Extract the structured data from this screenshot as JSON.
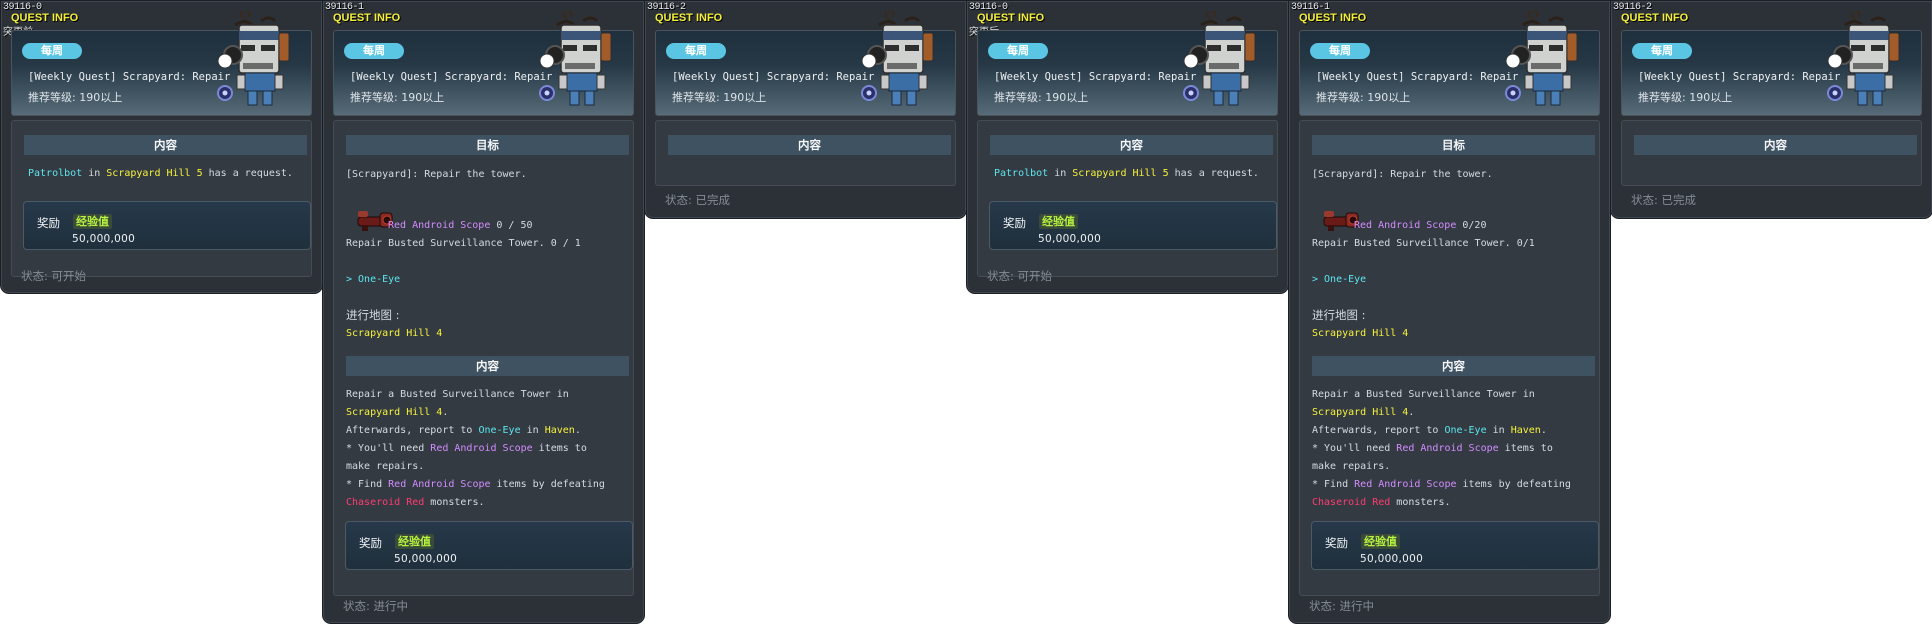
{
  "panels": [
    {
      "id": "39116-0",
      "header_label": "QUEST INFO",
      "sub_label": "突更前",
      "badge": "每周",
      "quest_name": "[Weekly Quest] Scrapyard: Repair",
      "level": "推荐等级: 190以上",
      "content_title": "内容",
      "content_line": {
        "npc": "Patrolbot",
        "in": " in ",
        "map": "Scrapyard Hill 5",
        "rest": " has a request."
      },
      "reward": {
        "label": "奖励",
        "type": "经验值",
        "value": "50,000,000"
      },
      "status": "状态:  可开始"
    },
    {
      "id": "39116-1",
      "header_label": "QUEST INFO",
      "badge": "每周",
      "quest_name": "[Weekly Quest] Scrapyard: Repair",
      "level": "推荐等级: 190以上",
      "goal_title": "目标",
      "goal_text": "[Scrapyard]: Repair the tower.",
      "item_progress": {
        "name": "Red Android Scope",
        "count": " 0 / 50"
      },
      "task_progress": "Repair Busted Surveillance Tower. 0 / 1",
      "npc_link": "> One-Eye",
      "map_label": "进行地图 :",
      "map_name": "Scrapyard Hill 4",
      "content_title": "内容",
      "desc": [
        [
          {
            "t": "Repair a Busted Surveillance Tower in"
          }
        ],
        [
          {
            "t": "Scrapyard Hill 4",
            "c": "yellow"
          },
          {
            "t": "."
          }
        ],
        [
          {
            "t": "Afterwards, report to "
          },
          {
            "t": "One-Eye",
            "c": "cyan"
          },
          {
            "t": " in "
          },
          {
            "t": "Haven",
            "c": "yellow"
          },
          {
            "t": "."
          }
        ],
        [
          {
            "t": "* You'll need "
          },
          {
            "t": "Red Android Scope",
            "c": "purple"
          },
          {
            "t": " items to"
          }
        ],
        [
          {
            "t": "make repairs."
          }
        ],
        [
          {
            "t": "* Find "
          },
          {
            "t": "Red Android Scope",
            "c": "purple"
          },
          {
            "t": " items by defeating"
          }
        ],
        [
          {
            "t": "Chaseroid Red",
            "c": "red"
          },
          {
            "t": " monsters."
          }
        ]
      ],
      "reward": {
        "label": "奖励",
        "type": "经验值",
        "value": "50,000,000"
      },
      "status": "状态:  进行中"
    },
    {
      "id": "39116-2",
      "header_label": "QUEST INFO",
      "badge": "每周",
      "quest_name": "[Weekly Quest] Scrapyard: Repair",
      "level": "推荐等级: 190以上",
      "content_title": "内容",
      "status": "状态:  已完成"
    },
    {
      "id": "39116-0",
      "header_label": "QUEST INFO",
      "sub_label": "突更后",
      "badge": "每周",
      "quest_name": "[Weekly Quest] Scrapyard: Repair",
      "level": "推荐等级: 190以上",
      "content_title": "内容",
      "content_line": {
        "npc": "Patrolbot",
        "in": " in ",
        "map": "Scrapyard Hill 5",
        "rest": " has a request."
      },
      "reward": {
        "label": "奖励",
        "type": "经验值",
        "value": "50,000,000"
      },
      "status": "状态:  可开始"
    },
    {
      "id": "39116-1",
      "header_label": "QUEST INFO",
      "badge": "每周",
      "quest_name": "[Weekly Quest] Scrapyard: Repair",
      "level": "推荐等级: 190以上",
      "goal_title": "目标",
      "goal_text": "[Scrapyard]: Repair the tower.",
      "item_progress": {
        "name": "Red Android Scope",
        "count": " 0/20"
      },
      "task_progress": "Repair Busted Surveillance Tower. 0/1",
      "npc_link": "> One-Eye",
      "map_label": "进行地图 :",
      "map_name": "Scrapyard Hill 4",
      "content_title": "内容",
      "desc": [
        [
          {
            "t": "Repair a Busted Surveillance Tower in"
          }
        ],
        [
          {
            "t": "Scrapyard Hill 4",
            "c": "yellow"
          },
          {
            "t": "."
          }
        ],
        [
          {
            "t": "Afterwards, report to "
          },
          {
            "t": "One-Eye",
            "c": "cyan"
          },
          {
            "t": " in "
          },
          {
            "t": "Haven",
            "c": "yellow"
          },
          {
            "t": "."
          }
        ],
        [
          {
            "t": "* You'll need "
          },
          {
            "t": "Red Android Scope",
            "c": "purple"
          },
          {
            "t": " items to"
          }
        ],
        [
          {
            "t": "make repairs."
          }
        ],
        [
          {
            "t": "* Find "
          },
          {
            "t": "Red Android Scope",
            "c": "purple"
          },
          {
            "t": " items by defeating"
          }
        ],
        [
          {
            "t": "Chaseroid Red",
            "c": "red"
          },
          {
            "t": " monsters."
          }
        ]
      ],
      "reward": {
        "label": "奖励",
        "type": "经验值",
        "value": "50,000,000"
      },
      "status": "状态:  进行中"
    },
    {
      "id": "39116-2",
      "header_label": "QUEST INFO",
      "badge": "每周",
      "quest_name": "[Weekly Quest] Scrapyard: Repair",
      "level": "推荐等级: 190以上",
      "content_title": "内容",
      "status": "状态:  已完成"
    }
  ],
  "colors": {
    "cyan": "#5ce6ef",
    "yellow": "#f6f23a",
    "purple": "#d28cff",
    "red": "#ff3d6f",
    "badge": "#5bc6e3"
  },
  "icons": {
    "npc": "patrolbot-robot-icon",
    "item": "red-android-scope-icon"
  }
}
